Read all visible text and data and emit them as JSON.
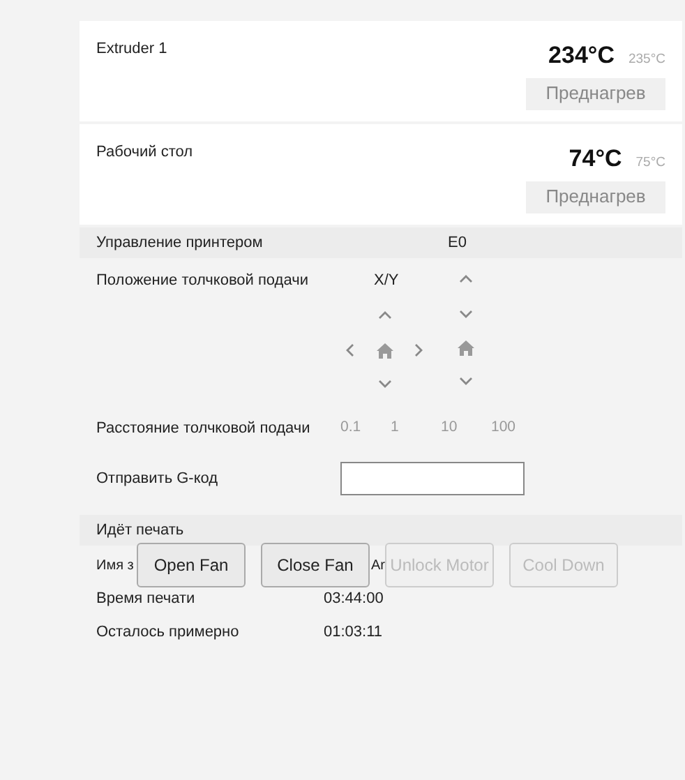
{
  "heaters": [
    {
      "name": "Extruder 1",
      "current": "234°C",
      "target": "235°C",
      "button": "Преднагрев"
    },
    {
      "name": "Рабочий стол",
      "current": "74°C",
      "target": "75°C",
      "button": "Преднагрев"
    }
  ],
  "control": {
    "title": "Управление принтером",
    "extruder_label": "E0",
    "jog_label": "Положение толчковой подачи",
    "xy_label": "X/Y",
    "distance_label": "Расстояние толчковой подачи",
    "distances": [
      "0.1",
      "1",
      "10",
      "100"
    ],
    "gcode_label": "Отправить G-код"
  },
  "printing": {
    "title": "Идёт печать",
    "rows": [
      {
        "label": "Имя з",
        "value": "Ar"
      },
      {
        "label": "Время печати",
        "value": "03:44:00"
      },
      {
        "label": "Осталось примерно",
        "value": "01:03:11"
      }
    ]
  },
  "overlay_buttons": [
    {
      "label": "Open Fan",
      "disabled": false
    },
    {
      "label": "Close Fan",
      "disabled": false
    },
    {
      "label": "Unlock Motor",
      "disabled": true
    },
    {
      "label": "Cool Down",
      "disabled": true
    }
  ]
}
